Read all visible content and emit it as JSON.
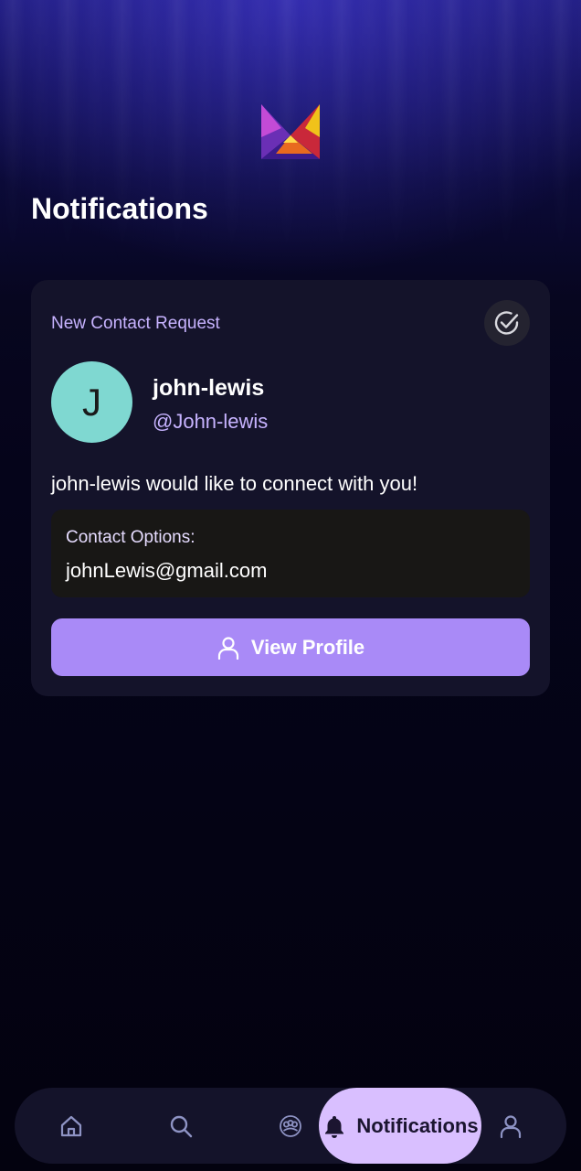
{
  "header": {
    "logo_icon": "app-logo-icon",
    "title": "Notifications"
  },
  "notification": {
    "type_label": "New Contact Request",
    "mark_read_icon": "check-circle-icon",
    "avatar_initial": "J",
    "avatar_color": "#7fd8d1",
    "user_name": "john-lewis",
    "user_handle": "@John-lewis",
    "message": "john-lewis would like to connect with you!",
    "contact_options": {
      "label": "Contact Options:",
      "value": "johnLewis@gmail.com"
    },
    "view_profile_button": {
      "icon": "user-icon",
      "label": "View Profile",
      "color": "#a98af7"
    }
  },
  "bottom_nav": {
    "items": [
      {
        "icon": "home-icon",
        "label": ""
      },
      {
        "icon": "search-icon",
        "label": ""
      },
      {
        "icon": "community-icon",
        "label": ""
      },
      {
        "icon": "bell-icon",
        "label": "Notifications",
        "active": true
      },
      {
        "icon": "profile-icon",
        "label": ""
      }
    ],
    "active_color": "#d9bfff"
  },
  "colors": {
    "accent": "#a98af7",
    "accent_text": "#c7b3ff",
    "background": "#05041a",
    "card": "#14132a"
  }
}
